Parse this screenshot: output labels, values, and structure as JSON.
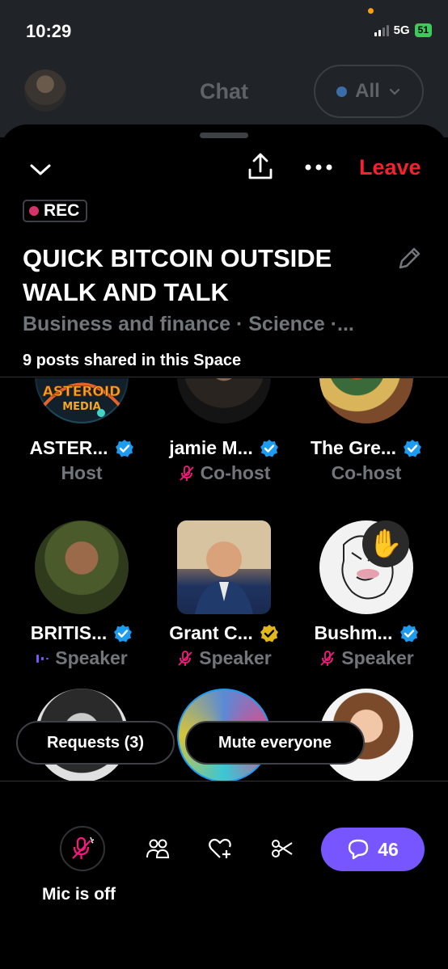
{
  "status_bar": {
    "time": "10:29",
    "network": "5G",
    "battery": "51"
  },
  "chat_header": {
    "title": "Chat",
    "filter_label": "All"
  },
  "space": {
    "leave_label": "Leave",
    "rec_label": "REC",
    "title": "QUICK BITCOIN OUTSIDE WALK AND TALK",
    "topics": "Business and finance · Science ·...",
    "posts_shared": "9 posts shared in this Space"
  },
  "participants": [
    {
      "name": "ASTER...",
      "role": "Host",
      "verified": "blue",
      "mic": "none"
    },
    {
      "name": "jamie M...",
      "role": "Co-host",
      "verified": "blue",
      "mic": "muted"
    },
    {
      "name": "The Gre...",
      "role": "Co-host",
      "verified": "blue",
      "mic": "none"
    },
    {
      "name": "BRITIS...",
      "role": "Speaker",
      "verified": "blue",
      "mic": "speaking"
    },
    {
      "name": "Grant C...",
      "role": "Speaker",
      "verified": "gold",
      "mic": "muted"
    },
    {
      "name": "Bushm...",
      "role": "Speaker",
      "verified": "blue",
      "mic": "muted"
    }
  ],
  "avatar_logo_text": "ASTEROID MEDIA",
  "actions": {
    "requests_label": "Requests (3)",
    "mute_everyone_label": "Mute everyone",
    "mic_status_label": "Mic is off",
    "comments_count": "46"
  },
  "colors": {
    "accent": "#7856ff",
    "leave": "#f4212e",
    "verified_blue": "#1d9bf0",
    "verified_gold": "#e2b719",
    "muted_pink": "#f91880",
    "rec_dot": "#d6336c"
  },
  "icons": [
    "chevron-down-icon",
    "share-icon",
    "more-icon",
    "pencil-icon",
    "mic-off-icon",
    "people-icon",
    "heart-plus-icon",
    "scissors-icon",
    "comment-icon",
    "raised-hand-icon"
  ]
}
